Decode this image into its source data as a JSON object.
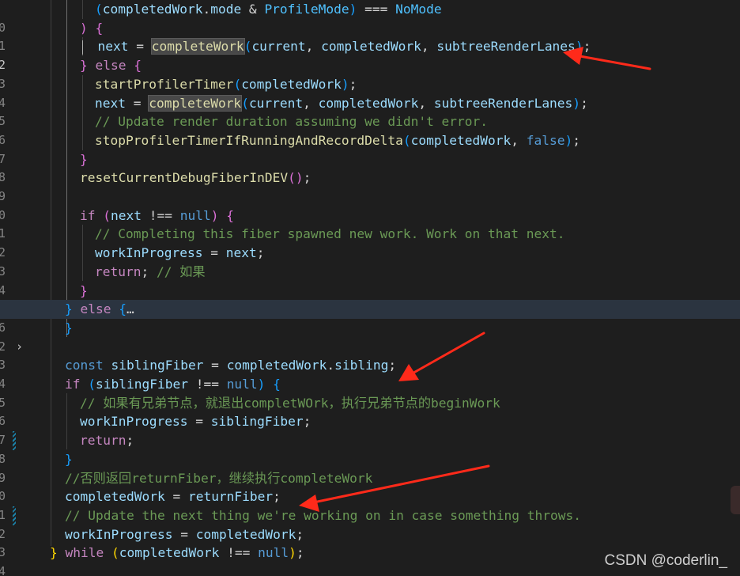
{
  "editor": {
    "gutter": {
      "line_numbers": [
        "0",
        "1",
        "2",
        "3",
        "4",
        "5",
        "6",
        "7",
        "8",
        "9",
        "0",
        "1",
        "2",
        "3",
        "4",
        "5",
        "6",
        "2",
        "3",
        "4",
        "5",
        "6",
        "7",
        "8",
        "9",
        "0",
        "1",
        "2",
        "3",
        "4"
      ],
      "fold_icon": "chevron-right-icon"
    },
    "tokens": {
      "completedWork": "completedWork",
      "mode": "mode",
      "ProfileMode": "ProfileMode",
      "NoMode": "NoMode",
      "next": "next",
      "completeWork": "completeWork",
      "current": "current",
      "subtreeRenderLanes": "subtreeRenderLanes",
      "else": "else",
      "startProfilerTimer": "startProfilerTimer",
      "stopProfilerTimerIfRunningAndRecordDelta": "stopProfilerTimerIfRunningAndRecordDelta",
      "false": "false",
      "resetCurrentDebugFiberInDEV": "resetCurrentDebugFiberInDEV",
      "if": "if",
      "null": "null",
      "workInProgress": "workInProgress",
      "return": "return",
      "const": "const",
      "siblingFiber": "siblingFiber",
      "sibling": "sibling",
      "returnFiber": "returnFiber",
      "while": "while",
      "ellipsis": "…"
    },
    "comments": {
      "update_render_duration": "// Update render duration assuming we didn't error.",
      "completing_fiber": "// Completing this fiber spawned new work. Work on that next.",
      "if_cn": "// 如果",
      "sibling_cn": "// 如果有兄弟节点，就退出completWOrk，执行兄弟节点的beginWork",
      "return_cn": "//否则返回returnFiber，继续执行completeWork",
      "update_next": "// Update the next thing we're working on in case something throws."
    }
  },
  "annotation_colors": {
    "arrow": "#ff2a1a"
  },
  "watermark": "CSDN @coderlin_"
}
